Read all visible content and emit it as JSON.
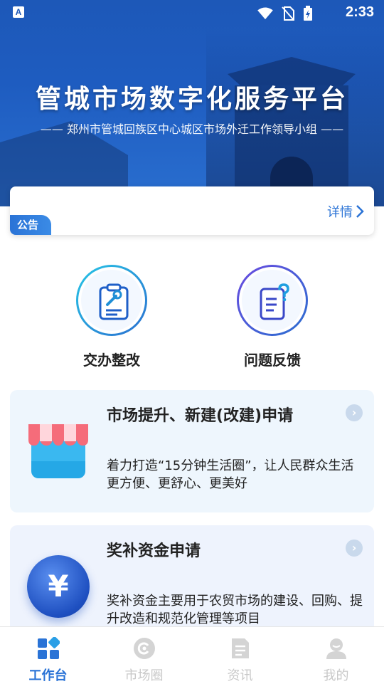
{
  "status_bar": {
    "time": "2:33",
    "app_badge": "A"
  },
  "hero": {
    "title": "管城市场数字化服务平台",
    "subtitle": "—— 郑州市管城回族区中心城区市场外迁工作领导小组 ——"
  },
  "notice": {
    "tag": "公告",
    "detail_label": "详情"
  },
  "quick_actions": [
    {
      "label": "交办整改",
      "icon": "clipboard-wrench-icon"
    },
    {
      "label": "问题反馈",
      "icon": "document-question-icon"
    }
  ],
  "service_cards": [
    {
      "title": "市场提升、新建(改建)申请",
      "description": "着力打造“15分钟生活圈”，让人民群众生活更方便、更舒心、更美好",
      "icon": "storefront-icon"
    },
    {
      "title": "奖补资金申请",
      "description": "奖补资金主要用于农贸市场的建设、回购、提升改造和规范化管理等项目",
      "icon": "yuan-coin-icon",
      "icon_glyph": "¥"
    }
  ],
  "bottom_nav": [
    {
      "label": "工作台",
      "icon": "workbench-icon",
      "active": true
    },
    {
      "label": "市场圈",
      "icon": "market-circle-icon",
      "active": false
    },
    {
      "label": "资讯",
      "icon": "news-icon",
      "active": false
    },
    {
      "label": "我的",
      "icon": "profile-icon",
      "active": false
    }
  ],
  "colors": {
    "primary": "#2a73d6",
    "hero": "#1d58b8",
    "inactive": "#c8c8c8"
  }
}
